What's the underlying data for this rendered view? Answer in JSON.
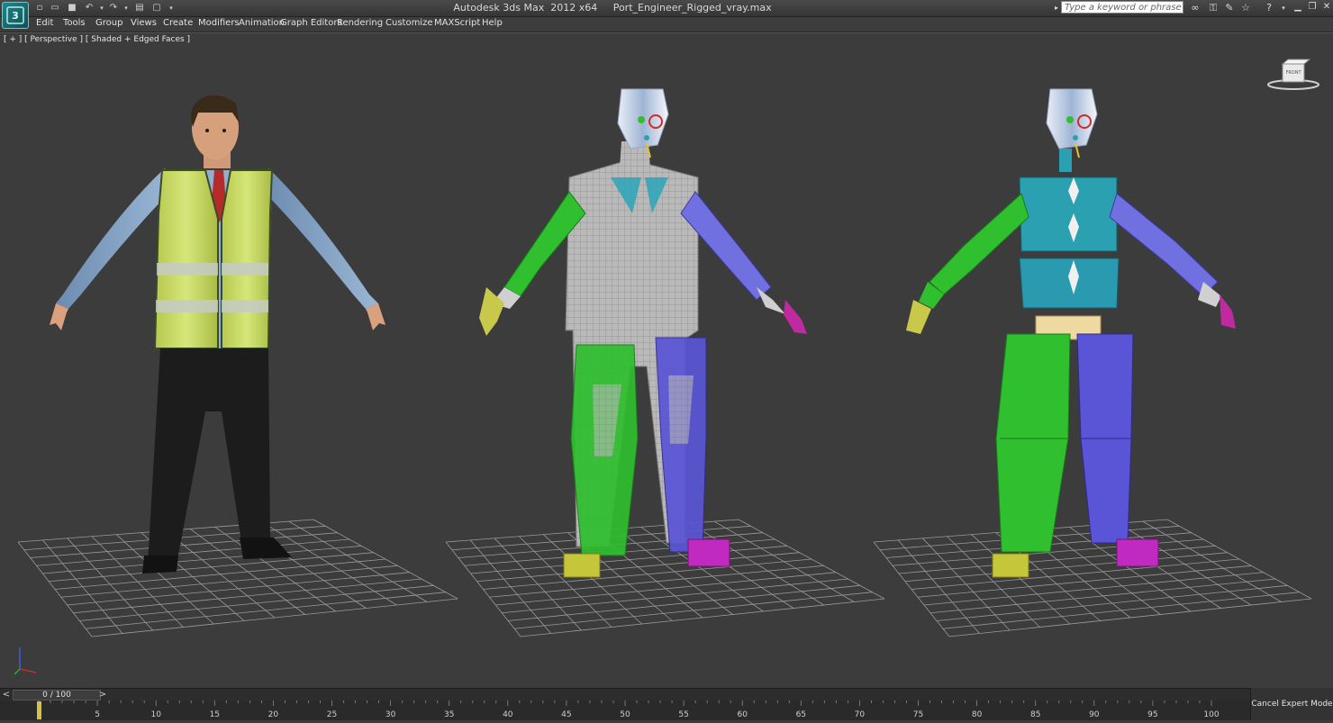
{
  "window": {
    "title": "Autodesk 3ds Max  2012 x64     Port_Engineer_Rigged_vray.max",
    "search_placeholder": "Type a keyword or phrase"
  },
  "menu": [
    "Edit",
    "Tools",
    "Group",
    "Views",
    "Create",
    "Modifiers",
    "Animation",
    "Graph Editors",
    "Rendering",
    "Customize",
    "MAXScript",
    "Help"
  ],
  "viewport": {
    "label": "[ + ] [ Perspective ] [ Shaded + Edged Faces ]",
    "viewcube_label": "FRONT"
  },
  "timeline": {
    "frame_display": "0 / 100",
    "prev_label": "<",
    "next_label": ">",
    "ticks": [
      "5",
      "10",
      "15",
      "20",
      "25",
      "30",
      "35",
      "40",
      "45",
      "50",
      "55",
      "60",
      "65",
      "70",
      "75",
      "80",
      "85",
      "90",
      "95",
      "100"
    ]
  },
  "status": {
    "cancel_expert_label": "Cancel Expert Mode"
  },
  "colors": {
    "viewport_bg": "#3c3c3c",
    "grid": "#9a9a9a",
    "biped_green": "#2fbf2f",
    "biped_blue": "#5a55d6",
    "biped_cyan": "#2aa0b0",
    "vest_yellow": "#cde06a"
  }
}
